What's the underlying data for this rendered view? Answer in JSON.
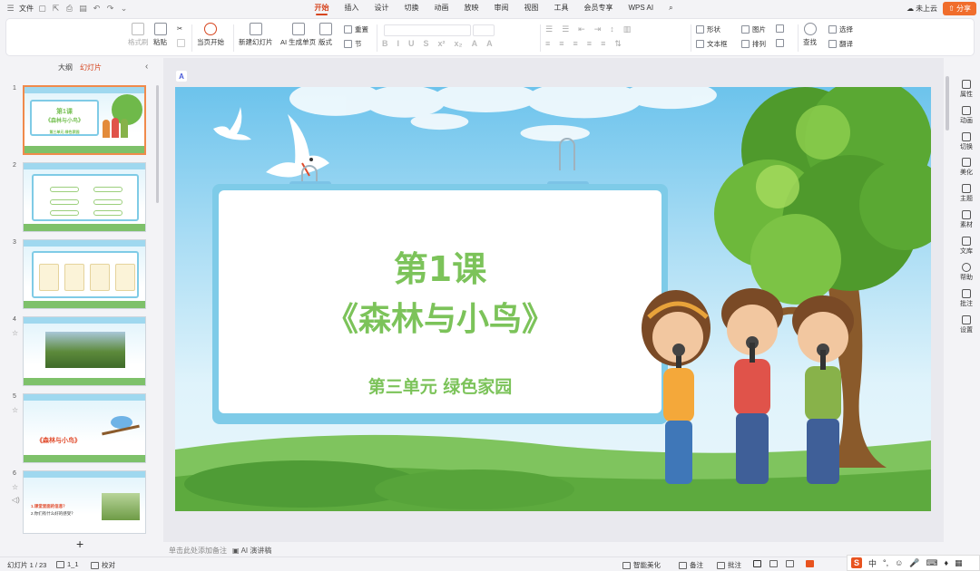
{
  "menubar": {
    "file_label": "文件",
    "tabs": [
      "开始",
      "插入",
      "设计",
      "切换",
      "动画",
      "放映",
      "审阅",
      "视图",
      "工具",
      "会员专享",
      "WPS AI"
    ],
    "cloud_label": "未上云",
    "share_label": "分享"
  },
  "ribbon": {
    "format_brush": "格式刷",
    "paste": "粘贴",
    "play_current": "当页开始",
    "new_slide": "新建幻灯片",
    "ai_generate": "AI 生成单页",
    "layout": "版式",
    "reset": "重置",
    "section": "节",
    "shape": "形状",
    "picture": "图片",
    "textbox": "文本框",
    "arrange": "排列",
    "find": "查找",
    "select": "选择",
    "translate": "翻译"
  },
  "leftpanel": {
    "tab_outline": "大纲",
    "tab_slides": "幻灯片",
    "slide_numbers": [
      "1",
      "2",
      "3",
      "4",
      "5",
      "6"
    ],
    "thumb1_title": "第1课",
    "thumb1_subtitle": "《森林与小鸟》",
    "thumb1_unit": "第三单元  绿色家园",
    "thumb5_title": "《森林与小鸟》",
    "thumb6_line1": "1.课堂里面的信息？",
    "thumb6_line2": "2.你们有什么好的感受？"
  },
  "slide": {
    "title_line1": "第1课",
    "title_line2": "《森林与小鸟》",
    "subtitle": "第三单元  绿色家园"
  },
  "notes": {
    "placeholder": "单击此处添加备注",
    "ai_lecture": "AI 演讲稿"
  },
  "rightbar": {
    "items": [
      "属性",
      "动画",
      "切换",
      "美化",
      "主题",
      "素材",
      "文库",
      "帮助",
      "批注",
      "设置"
    ]
  },
  "statusbar": {
    "slide_count": "幻灯片 1 / 23",
    "theme": "1_1",
    "proof": "校对",
    "smart_beautify": "智能美化",
    "notes": "备注",
    "comments": "批注"
  },
  "ime": {
    "mode": "中"
  },
  "colors": {
    "accent": "#d6451f",
    "title_green": "#7cc35a",
    "card_border": "#7ecbe8",
    "share_bg": "#f06d2c"
  }
}
